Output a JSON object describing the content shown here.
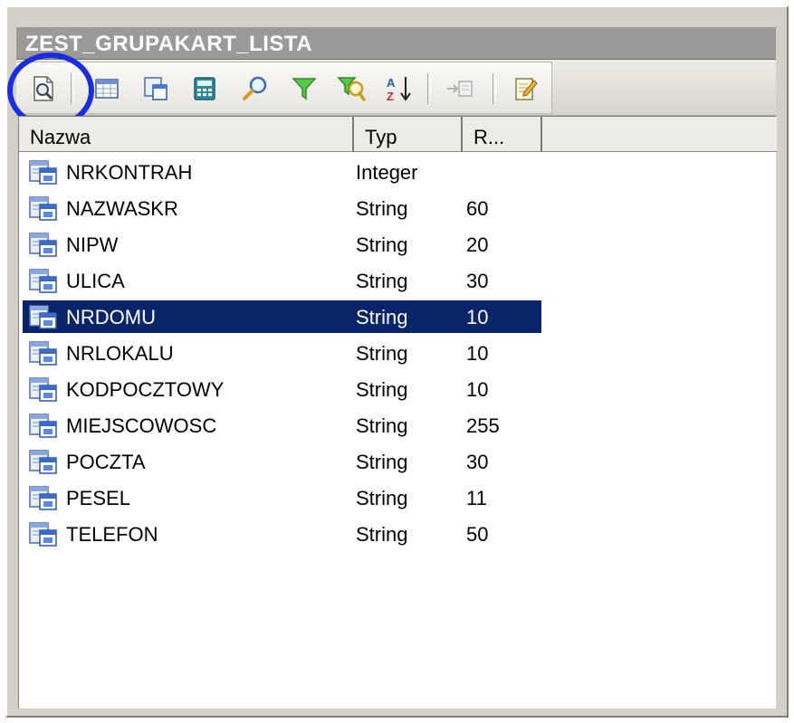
{
  "window": {
    "title": "ZEST_GRUPAKART_LISTA"
  },
  "toolbar": {
    "buttons": [
      {
        "name": "preview-icon"
      },
      {
        "name": "grid-icon"
      },
      {
        "name": "field-list-icon"
      },
      {
        "name": "calculator-icon"
      },
      {
        "name": "search-icon"
      },
      {
        "name": "filter-icon"
      },
      {
        "name": "filter-search-icon"
      },
      {
        "name": "sort-az-icon"
      },
      {
        "name": "insert-field-icon"
      },
      {
        "name": "edit-note-icon"
      }
    ]
  },
  "list": {
    "columns": [
      "Nazwa",
      "Typ",
      "R..."
    ],
    "rows": [
      {
        "name": "NRKONTRAH",
        "type": "Integer",
        "length": ""
      },
      {
        "name": "NAZWASKR",
        "type": "String",
        "length": "60"
      },
      {
        "name": "NIPW",
        "type": "String",
        "length": "20"
      },
      {
        "name": "ULICA",
        "type": "String",
        "length": "30"
      },
      {
        "name": "NRDOMU",
        "type": "String",
        "length": "10",
        "selected": true
      },
      {
        "name": "NRLOKALU",
        "type": "String",
        "length": "10"
      },
      {
        "name": "KODPOCZTOWY",
        "type": "String",
        "length": "10"
      },
      {
        "name": "MIEJSCOWOSC",
        "type": "String",
        "length": "255"
      },
      {
        "name": "POCZTA",
        "type": "String",
        "length": "30"
      },
      {
        "name": "PESEL",
        "type": "String",
        "length": "11"
      },
      {
        "name": "TELEFON",
        "type": "String",
        "length": "50"
      }
    ],
    "selection_color": "#0a246a"
  },
  "annotation": {
    "color": "#1a2ee0",
    "shape": "circle"
  }
}
